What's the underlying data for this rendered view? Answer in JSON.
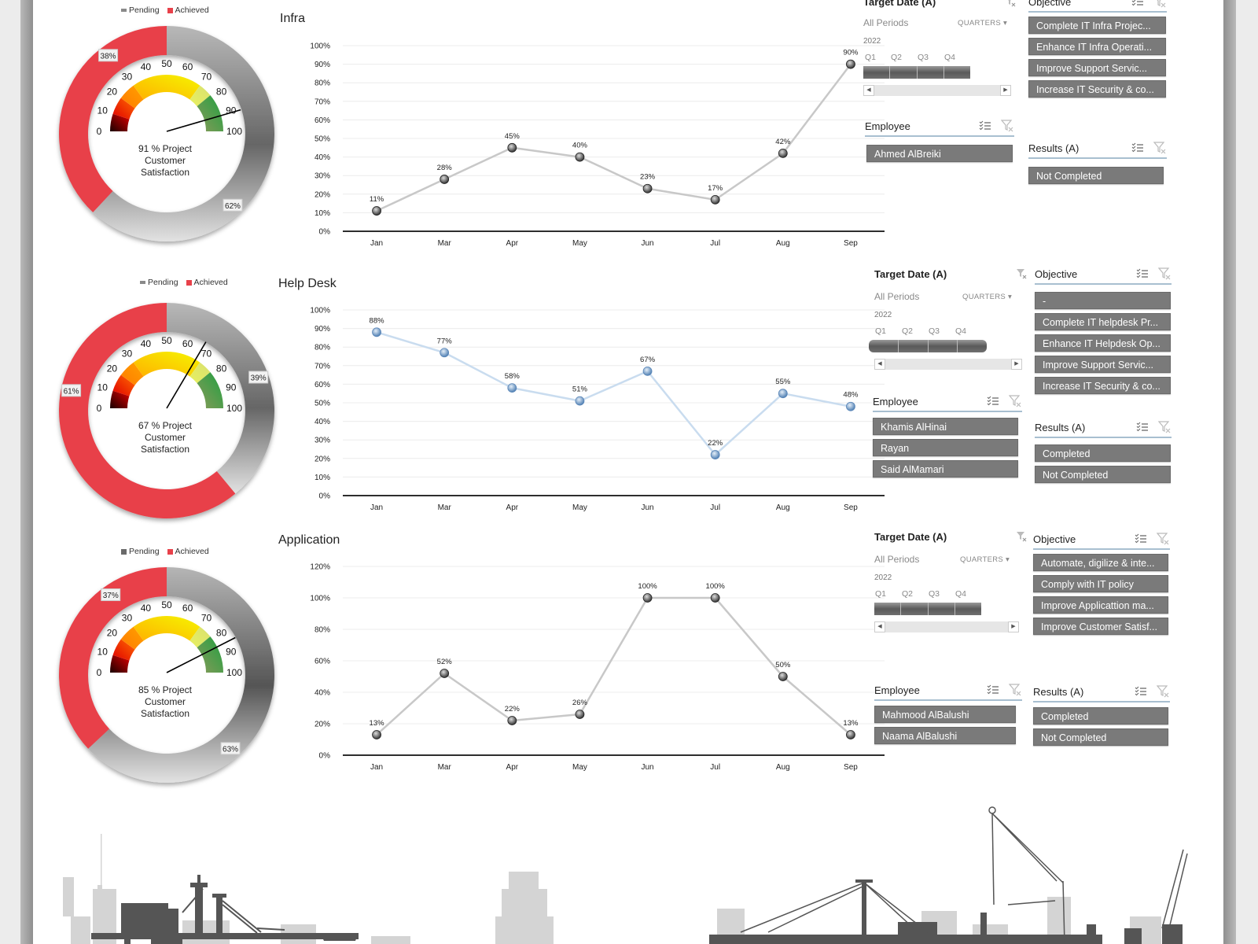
{
  "legend": {
    "pending": "Pending",
    "achieved": "Achieved"
  },
  "colors": {
    "achieved": "#e8414a",
    "pending": "#8a8a8a",
    "infra_line": "#c8c8c8",
    "helpdesk_line": "#c9dcef",
    "helpdesk_marker": "#6d97c4",
    "slicer_item": "#7a7a7a",
    "slicer_underline": "#a8bfd0"
  },
  "gauge_scale": [
    "0",
    "10",
    "20",
    "30",
    "40",
    "50",
    "60",
    "70",
    "80",
    "90",
    "100"
  ],
  "sections": [
    {
      "name": "Infra",
      "donut": {
        "achieved_pct": 38,
        "pending_pct": 62,
        "achieved_label": "38%",
        "pending_label": "62%"
      },
      "gauge": {
        "value": 91,
        "caption_line1": "91 % Project",
        "caption_line2": "Customer",
        "caption_line3": "Satisfaction"
      },
      "slicers": {
        "target_date": {
          "title": "Target Date (A)",
          "all_periods": "All Periods",
          "granularity": "QUARTERS",
          "year": "2022",
          "quarters": [
            "Q1",
            "Q2",
            "Q3",
            "Q4"
          ]
        },
        "objective": {
          "title": "Objective",
          "items": [
            "Complete IT Infra Projec...",
            "Enhance IT Infra Operati...",
            "Improve  Support Servic...",
            "Increase IT Security & co..."
          ]
        },
        "employee": {
          "title": "Employee",
          "items": [
            "Ahmed AlBreiki"
          ]
        },
        "results": {
          "title": "Results (A)",
          "items": [
            "Not Completed"
          ]
        }
      }
    },
    {
      "name": "Help Desk",
      "donut": {
        "achieved_pct": 61,
        "pending_pct": 39,
        "achieved_label": "61%",
        "pending_label": "39%"
      },
      "gauge": {
        "value": 67,
        "caption_line1": "67 % Project",
        "caption_line2": "Customer",
        "caption_line3": "Satisfaction"
      },
      "slicers": {
        "target_date": {
          "title": "Target Date (A)",
          "all_periods": "All Periods",
          "granularity": "QUARTERS",
          "year": "2022",
          "quarters": [
            "Q1",
            "Q2",
            "Q3",
            "Q4"
          ]
        },
        "objective": {
          "title": "Objective",
          "items": [
            "-",
            "Complete IT helpdesk Pr...",
            "Enhance IT Helpdesk Op...",
            "Improve  Support Servic...",
            "Increase IT Security & co..."
          ]
        },
        "employee": {
          "title": "Employee",
          "items": [
            "Khamis AlHinai",
            "Rayan",
            "Said AlMamari"
          ]
        },
        "results": {
          "title": "Results (A)",
          "items": [
            "Completed",
            "Not Completed"
          ]
        }
      }
    },
    {
      "name": "Application",
      "donut": {
        "achieved_pct": 37,
        "pending_pct": 63,
        "achieved_label": "37%",
        "pending_label": "63%"
      },
      "gauge": {
        "value": 85,
        "caption_line1": "85 % Project",
        "caption_line2": "Customer",
        "caption_line3": "Satisfaction"
      },
      "slicers": {
        "target_date": {
          "title": "Target Date (A)",
          "all_periods": "All Periods",
          "granularity": "QUARTERS",
          "year": "2022",
          "quarters": [
            "Q1",
            "Q2",
            "Q3",
            "Q4"
          ]
        },
        "objective": {
          "title": "Objective",
          "items": [
            "Automate, digilize & inte...",
            "Comply with IT policy",
            "Improve Applicattion ma...",
            "Improve Customer Satisf..."
          ]
        },
        "employee": {
          "title": "Employee",
          "items": [
            "Mahmood AlBalushi",
            "Naama AlBalushi"
          ]
        },
        "results": {
          "title": "Results (A)",
          "items": [
            "Completed",
            "Not Completed"
          ]
        }
      }
    }
  ],
  "chart_data": [
    {
      "type": "line",
      "title": "Infra",
      "categories": [
        "Jan",
        "Mar",
        "Apr",
        "May",
        "Jun",
        "Jul",
        "Aug",
        "Sep"
      ],
      "values": [
        11,
        28,
        45,
        40,
        23,
        17,
        42,
        90
      ],
      "data_labels": [
        "11%",
        "28%",
        "45%",
        "40%",
        "23%",
        "17%",
        "42%",
        "90%"
      ],
      "ylim": [
        0,
        100
      ],
      "yticks": [
        "0%",
        "10%",
        "20%",
        "30%",
        "40%",
        "50%",
        "60%",
        "70%",
        "80%",
        "90%",
        "100%"
      ],
      "grid": true,
      "xlabel": "",
      "ylabel": ""
    },
    {
      "type": "line",
      "title": "Help Desk",
      "categories": [
        "Jan",
        "Mar",
        "Apr",
        "May",
        "Jun",
        "Jul",
        "Aug",
        "Sep"
      ],
      "values": [
        88,
        77,
        58,
        51,
        67,
        22,
        55,
        48
      ],
      "data_labels": [
        "88%",
        "77%",
        "58%",
        "51%",
        "67%",
        "22%",
        "55%",
        "48%"
      ],
      "ylim": [
        0,
        100
      ],
      "yticks": [
        "0%",
        "10%",
        "20%",
        "30%",
        "40%",
        "50%",
        "60%",
        "70%",
        "80%",
        "90%",
        "100%"
      ],
      "grid": true,
      "xlabel": "",
      "ylabel": ""
    },
    {
      "type": "line",
      "title": "Application",
      "categories": [
        "Jan",
        "Mar",
        "Apr",
        "May",
        "Jun",
        "Jul",
        "Aug",
        "Sep"
      ],
      "values": [
        13,
        52,
        22,
        26,
        100,
        100,
        50,
        13
      ],
      "data_labels": [
        "13%",
        "52%",
        "22%",
        "26%",
        "100%",
        "100%",
        "50%",
        "13%"
      ],
      "ylim": [
        0,
        120
      ],
      "yticks": [
        "0%",
        "20%",
        "40%",
        "60%",
        "80%",
        "100%",
        "120%"
      ],
      "grid": true,
      "xlabel": "",
      "ylabel": ""
    }
  ]
}
